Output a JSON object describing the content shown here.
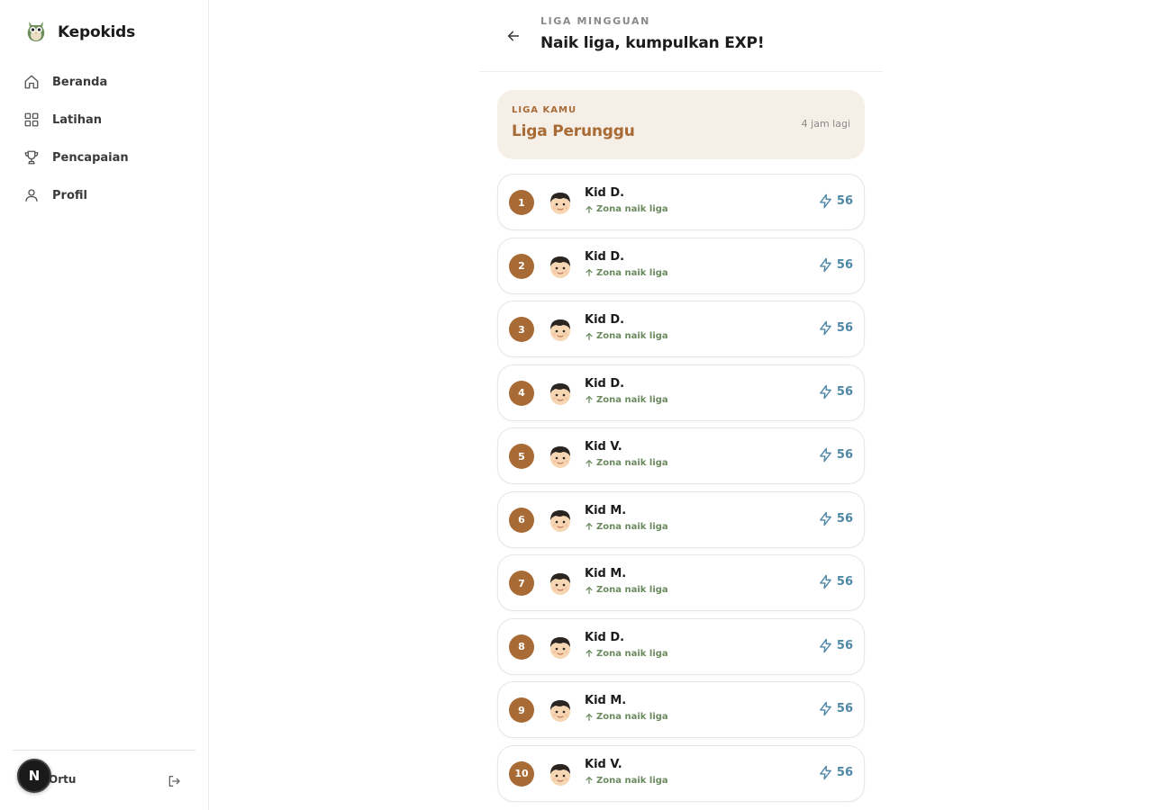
{
  "app": {
    "name": "Kepokids"
  },
  "sidebar": {
    "items": [
      {
        "label": "Beranda",
        "icon": "home-icon"
      },
      {
        "label": "Latihan",
        "icon": "grid-icon"
      },
      {
        "label": "Pencapaian",
        "icon": "trophy-icon"
      },
      {
        "label": "Profil",
        "icon": "user-icon"
      }
    ],
    "footer": {
      "user_name": "Ortu",
      "badge_letter": "N"
    }
  },
  "header": {
    "eyebrow": "LIGA MINGGUAN",
    "title": "Naik liga, kumpulkan EXP!"
  },
  "league": {
    "eyebrow": "LIGA KAMU",
    "name": "Liga Perunggu",
    "time_left": "4 jam lagi"
  },
  "leaderboard": [
    {
      "rank": "1",
      "name": "Kid D.",
      "zone": "Zona naik liga",
      "exp": "56"
    },
    {
      "rank": "2",
      "name": "Kid D.",
      "zone": "Zona naik liga",
      "exp": "56"
    },
    {
      "rank": "3",
      "name": "Kid D.",
      "zone": "Zona naik liga",
      "exp": "56"
    },
    {
      "rank": "4",
      "name": "Kid D.",
      "zone": "Zona naik liga",
      "exp": "56"
    },
    {
      "rank": "5",
      "name": "Kid V.",
      "zone": "Zona naik liga",
      "exp": "56"
    },
    {
      "rank": "6",
      "name": "Kid M.",
      "zone": "Zona naik liga",
      "exp": "56"
    },
    {
      "rank": "7",
      "name": "Kid M.",
      "zone": "Zona naik liga",
      "exp": "56"
    },
    {
      "rank": "8",
      "name": "Kid D.",
      "zone": "Zona naik liga",
      "exp": "56"
    },
    {
      "rank": "9",
      "name": "Kid M.",
      "zone": "Zona naik liga",
      "exp": "56"
    },
    {
      "rank": "10",
      "name": "Kid V.",
      "zone": "Zona naik liga",
      "exp": "56"
    }
  ],
  "colors": {
    "accent_bronze": "#a86b35",
    "league_card_bg": "#f5efe8",
    "zone_green": "#6b8a5e",
    "exp_blue": "#4f87a6"
  }
}
